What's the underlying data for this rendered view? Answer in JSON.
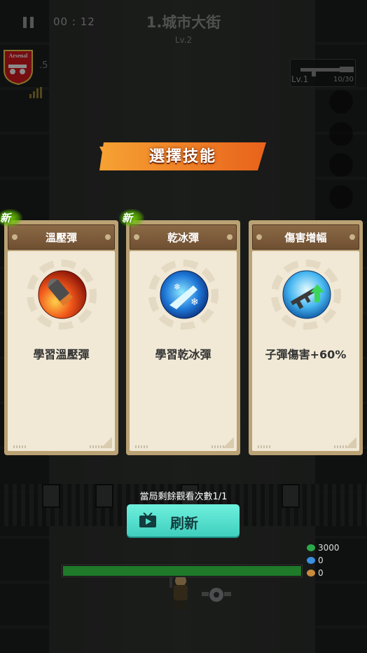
{
  "hud": {
    "timer": "00 : 12",
    "stage_title": "1.城市大街",
    "stage_level": "Lv.2",
    "crest_text": "Arsenal",
    "player_level": ".5",
    "weapon_level": "Lv.1",
    "weapon_count": "10/30"
  },
  "skill_select": {
    "title": "選擇技能",
    "cards": [
      {
        "name": "溫壓彈",
        "description": "學習溫壓彈",
        "is_new": true,
        "new_label": "新",
        "icon": "thermobaric-bullet-icon"
      },
      {
        "name": "乾冰彈",
        "description": "學習乾冰彈",
        "is_new": true,
        "new_label": "新",
        "icon": "dry-ice-bullet-icon"
      },
      {
        "name": "傷害增幅",
        "description": "子彈傷害+60%",
        "is_new": false,
        "new_label": "",
        "icon": "damage-boost-rifle-icon"
      }
    ]
  },
  "refresh": {
    "remaining_text": "當局剩餘觀看次數1/1",
    "button_label": "刷新",
    "icon": "tv-ad-icon"
  },
  "stats": {
    "health": "3000",
    "shield": "0",
    "coins": "0",
    "hp_fraction": 1.0
  },
  "colors": {
    "accent_orange": "#f07a1a",
    "refresh_teal": "#52e0cd",
    "card_header": "#7d5c3b",
    "new_green": "#6cc400"
  }
}
